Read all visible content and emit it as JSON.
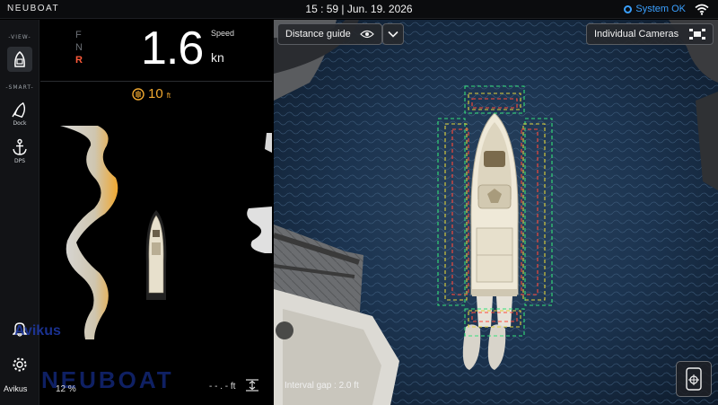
{
  "topbar": {
    "brand": "NEUBOAT",
    "clock": "15 : 59 | Jun. 19. 2026",
    "status": "System OK"
  },
  "nav": {
    "view_label": "VIEW",
    "smart_label": "SMART",
    "items": [
      {
        "label": ""
      },
      {
        "label": "Dock"
      },
      {
        "label": "DPS"
      }
    ],
    "avikus": "Avikus"
  },
  "panel": {
    "gears": [
      "F",
      "N",
      "R"
    ],
    "speed_value": "1.6",
    "speed_label": "Speed",
    "speed_unit": "kn",
    "depth_value": "10",
    "depth_unit": "ft",
    "bottom_value": "- - . -  ft",
    "battery": "12 %",
    "watermark_top": "Avikus",
    "watermark_bottom": "NEUBOAT"
  },
  "camera": {
    "distance_guide": "Distance guide",
    "individual_cameras": "Individual Cameras",
    "interval": "Interval gap : 2.0 ft"
  },
  "colors": {
    "accent": "#3aa0ff",
    "reverse": "#ff5a3a",
    "depth": "#f0a830",
    "guide_green": "#34e07a",
    "guide_yellow": "#e0d23a",
    "guide_red": "#ff4a3a"
  },
  "icons": [
    "wifi-icon",
    "view-boat-icon",
    "dock-icon",
    "anchor-icon",
    "bell-icon",
    "gear-icon",
    "eye-icon",
    "chevron-down-icon",
    "camera-grid-icon",
    "locate-icon",
    "depth-icon",
    "bottom-icon"
  ]
}
